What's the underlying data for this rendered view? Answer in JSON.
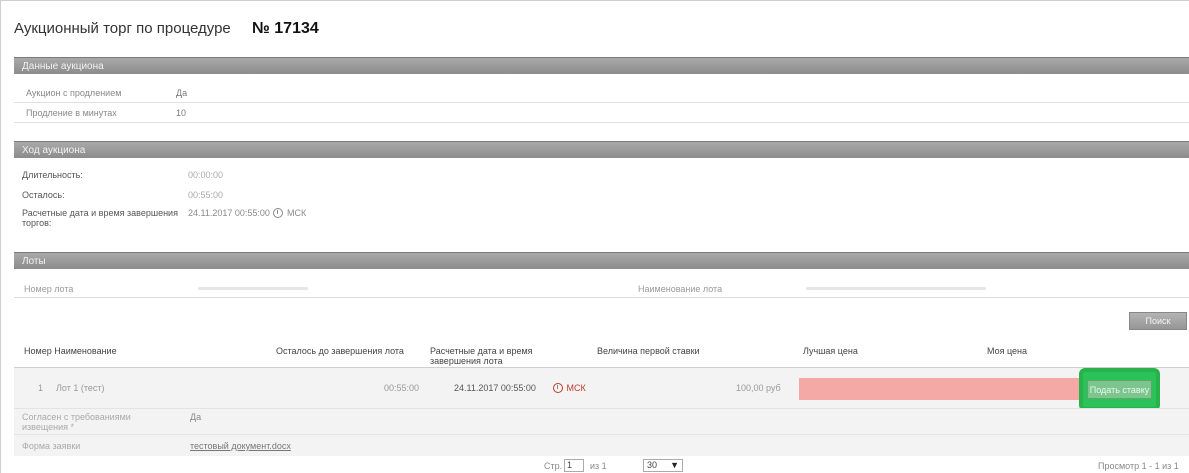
{
  "page": {
    "title": "Аукционный торг по процедуре",
    "number": "№ 17134"
  },
  "auction_data": {
    "header": "Данные аукциона",
    "rows": [
      {
        "label": "Аукцион с продлением",
        "value": "Да"
      },
      {
        "label": "Продление в минутах",
        "value": "10"
      }
    ]
  },
  "auction_progress": {
    "header": "Ход аукциона",
    "duration_label": "Длительность:",
    "duration_value": "00:00:00",
    "remaining_label": "Осталось:",
    "remaining_value": "00:55:00",
    "end_label": "Расчетные дата и время завершения торгов:",
    "end_value": "24.11.2017 00:55:00",
    "end_tz": "МСК"
  },
  "lots": {
    "header": "Лоты",
    "filter_number_label": "Номер лота",
    "filter_name_label": "Наименование лота",
    "search_label": "Поиск",
    "columns": {
      "number_name": "Номер Наименование",
      "remaining": "Осталось до завершения лота",
      "end_datetime": "Расчетные дата и время завершения лота",
      "first_bid": "Величина первой ставки",
      "best_price": "Лучшая цена",
      "my_price": "Моя цена"
    },
    "rows": [
      {
        "number": "1",
        "name": "Лот 1 (тест)",
        "remaining": "00:55:00",
        "end_date": "24.11.2017 00:55:00",
        "end_tz": "МСК",
        "first_bid": "100,00 руб",
        "bid_button": "Подать ставку",
        "agree_label": "Согласен с требованиями извещения *",
        "agree_value": "Да",
        "form_label": "Форма заявки",
        "form_value": "тестовый документ.docx"
      }
    ]
  },
  "pager": {
    "page_label": "Стр.",
    "page_value": "1",
    "of_label": "из 1",
    "per_page": "30",
    "summary": "Просмотр 1 - 1 из 1"
  },
  "colors": {
    "section_bar": "#999999",
    "best_price_bg": "#f4a9a6",
    "highlight": "#2cc25a",
    "red_text": "#c0392b"
  }
}
